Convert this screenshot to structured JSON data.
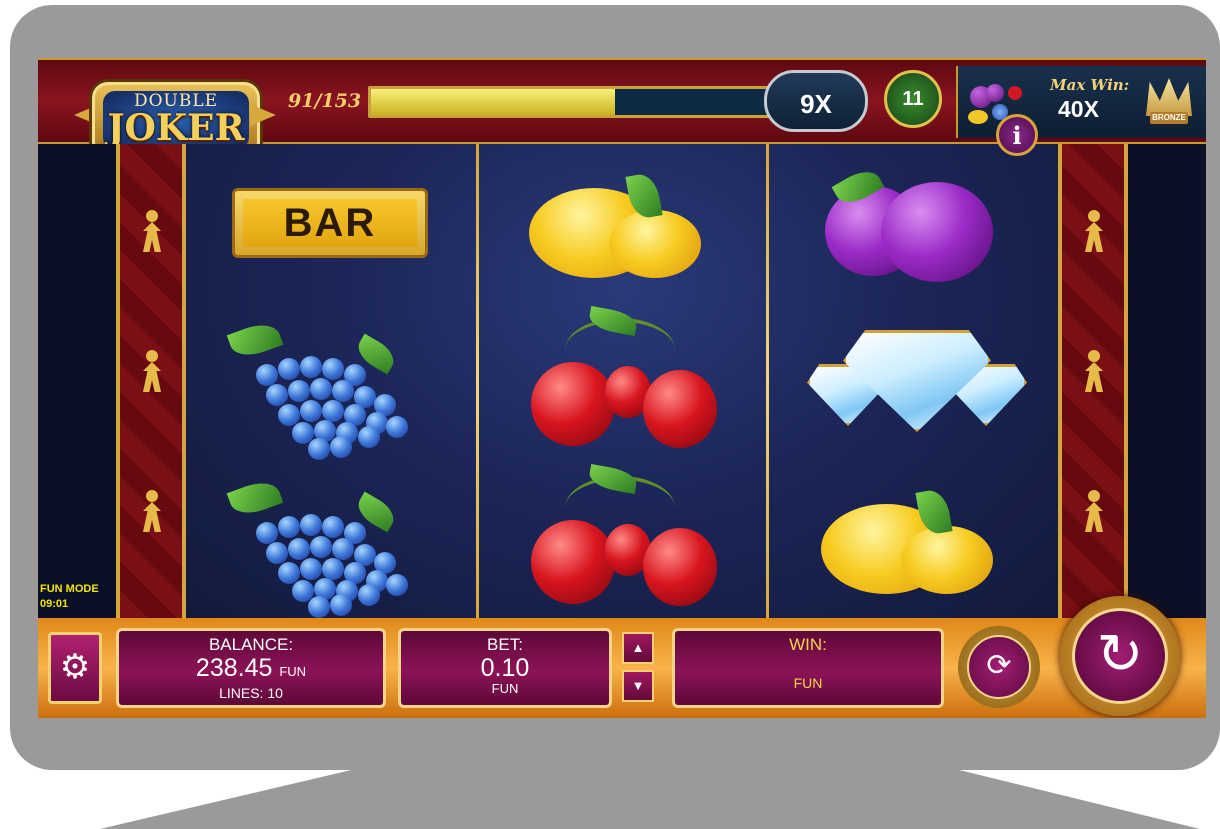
{
  "header": {
    "logo_small": "DOUBLE",
    "logo_big": "JOKER",
    "progress_text": "91/153",
    "progress_fraction": 0.595,
    "multiplier": "9X",
    "free_spins": "11",
    "max_win_label": "Max Win:",
    "max_win_value": "40X",
    "bronze_tag": "BRONZE",
    "info_label": "i"
  },
  "status": {
    "fun_mode": "FUN MODE",
    "time": "09:01"
  },
  "reels": [
    [
      "bar",
      "grapes",
      "grapes"
    ],
    [
      "lemon",
      "cherries",
      "cherries"
    ],
    [
      "plum",
      "diamonds",
      "lemon"
    ]
  ],
  "symbols": {
    "bar_text": "BAR"
  },
  "footer": {
    "balance_label": "BALANCE:",
    "balance_value": "238.45",
    "balance_unit": "FUN",
    "lines": "LINES: 10",
    "bet_label": "BET:",
    "bet_value": "0.10",
    "bet_unit": "FUN",
    "win_label": "WIN:",
    "win_unit": "FUN",
    "bet_up": "▲",
    "bet_down": "▼",
    "settings_icon": "⚙",
    "autoplay_icon": "⟳",
    "spin_icon": "↻"
  },
  "colors": {
    "accent_gold": "#d4a73c",
    "panel_purple": "#8c1356",
    "bar_orange": "#f8b34a"
  }
}
